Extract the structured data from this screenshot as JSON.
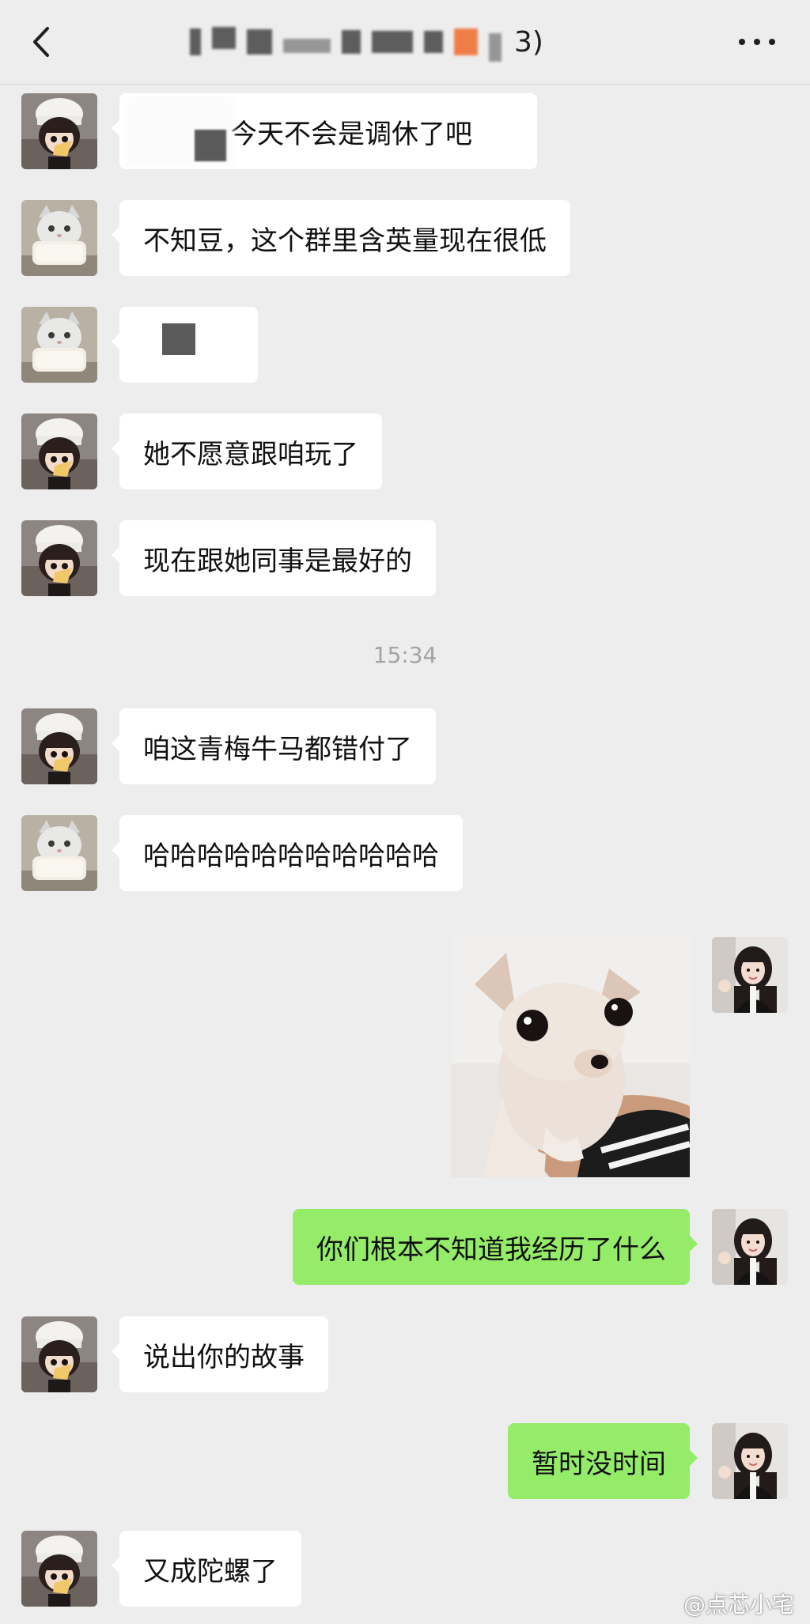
{
  "header": {
    "title_suffix": "3)",
    "back_icon": "chevron-left-icon",
    "more_icon": "more-dots-icon"
  },
  "timestamp": "15:34",
  "messages": [
    {
      "side": "in",
      "avatar": "chef-girl",
      "text": "今天不会是调休了吧"
    },
    {
      "side": "in",
      "avatar": "cat",
      "text": "不知豆，这个群里含英量现在很低"
    },
    {
      "side": "in",
      "avatar": "cat",
      "text": ""
    },
    {
      "side": "in",
      "avatar": "chef-girl",
      "text": "她不愿意跟咱玩了"
    },
    {
      "side": "in",
      "avatar": "chef-girl",
      "text": "现在跟她同事是最好的"
    },
    {
      "side": "in",
      "avatar": "chef-girl",
      "text": "咱这青梅牛马都错付了"
    },
    {
      "side": "in",
      "avatar": "cat",
      "text": "哈哈哈哈哈哈哈哈哈哈哈"
    },
    {
      "side": "out",
      "avatar": "self",
      "type": "sticker",
      "sticker": "chihuahua"
    },
    {
      "side": "out",
      "avatar": "self",
      "text": "你们根本不知道我经历了什么"
    },
    {
      "side": "in",
      "avatar": "chef-girl",
      "text": "说出你的故事"
    },
    {
      "side": "out",
      "avatar": "self",
      "text": "暂时没时间"
    },
    {
      "side": "in",
      "avatar": "chef-girl",
      "text": "又成陀螺了"
    }
  ],
  "watermark": "@点芯小宅",
  "colors": {
    "background": "#ededed",
    "incoming_bubble": "#ffffff",
    "outgoing_bubble": "#95ec69",
    "timestamp": "#a3a3a3"
  }
}
